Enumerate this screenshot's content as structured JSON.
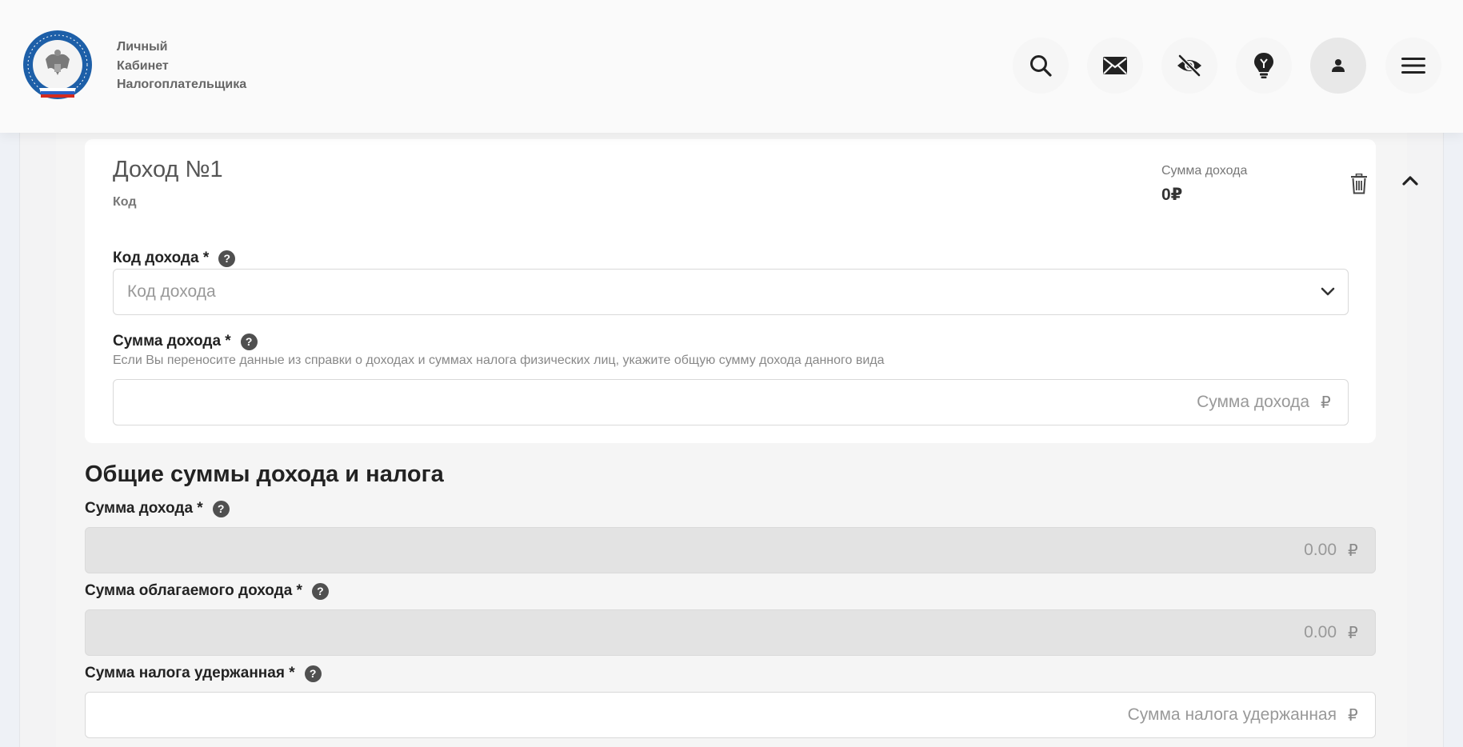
{
  "header": {
    "brand_line1": "Личный",
    "brand_line2": "Кабинет",
    "brand_line3": "Налогоплательщика",
    "icons": [
      "search-icon",
      "mail-icon",
      "eye-off-icon",
      "lightbulb-icon",
      "user-icon",
      "menu-icon"
    ]
  },
  "card": {
    "title": "Доход №1",
    "subtitle": "Код",
    "sum_label": "Сумма дохода",
    "sum_value": "0₽",
    "income_code": {
      "label": "Код дохода *",
      "placeholder": "Код дохода"
    },
    "income_sum": {
      "label": "Сумма дохода *",
      "hint": "Если Вы переносите данные из справки о доходах и суммах налога физических лиц, укажите общую сумму дохода данного вида",
      "placeholder": "Сумма дохода"
    }
  },
  "totals": {
    "title": "Общие суммы дохода и налога",
    "income_sum": {
      "label": "Сумма дохода *",
      "value": "0.00"
    },
    "taxable_sum": {
      "label": "Сумма облагаемого дохода *",
      "value": "0.00"
    },
    "withheld_tax": {
      "label": "Сумма налога удержанная *",
      "placeholder": "Сумма налога удержанная"
    }
  },
  "currency": "₽",
  "help_glyph": "?",
  "colors": {
    "accent": "#1d5fa8",
    "text": "#222222",
    "muted": "#888888",
    "disabled_bg": "#e3e3e3"
  }
}
